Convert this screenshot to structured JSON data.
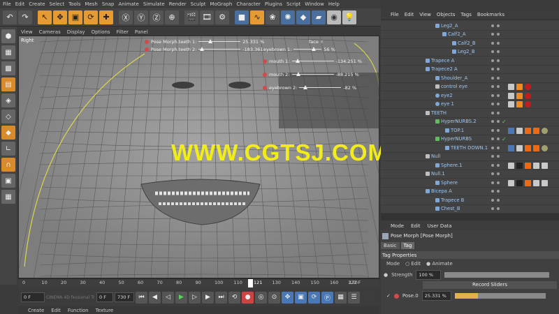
{
  "menubar": [
    "File",
    "Edit",
    "Create",
    "Select",
    "Tools",
    "Mesh",
    "Snap",
    "Animate",
    "Simulate",
    "Render",
    "Sculpt",
    "MoGraph",
    "Character",
    "Plugins",
    "Script",
    "Window",
    "Help"
  ],
  "viewport": {
    "menu": [
      "View",
      "Cameras",
      "Display",
      "Options",
      "Filter",
      "Panel"
    ],
    "name": "Right",
    "panel_label": "face",
    "sliders": [
      {
        "label": "Pose Morph.teeth 1:",
        "value": "25.331 %"
      },
      {
        "label": "Pose Morph.teeth 2:",
        "value": "-183.361"
      },
      {
        "label": "eyebrown 1:",
        "value": "56 %"
      },
      {
        "label": "mouth 1:",
        "value": "-134.251 %"
      },
      {
        "label": "mouth 2:",
        "value": "-88.215 %"
      },
      {
        "label": "eyebrown 2:",
        "value": "-82 %"
      }
    ]
  },
  "watermark": "WWW.CGTSJ.COM",
  "timeline": {
    "ticks": [
      "0",
      "10",
      "20",
      "30",
      "40",
      "50",
      "60",
      "70",
      "80",
      "90",
      "100",
      "110",
      "121",
      "130",
      "140",
      "150",
      "160",
      "170"
    ],
    "current_frame": "121",
    "end_frame": "122 F",
    "start_field": "0 F",
    "min_field": "0 F",
    "max_field": "730 F",
    "brand_text": "CINEMA 4D fessional Traini"
  },
  "bottom_menu": [
    "Create",
    "Edit",
    "Function",
    "Texture"
  ],
  "object_manager": {
    "menu": [
      "File",
      "Edit",
      "View",
      "Objects",
      "Tags",
      "Bookmarks"
    ],
    "rows": [
      {
        "name": "Leg2_A"
      },
      {
        "name": "Calf2_A"
      },
      {
        "name": "Calf2_B"
      },
      {
        "name": "Leg2_B"
      },
      {
        "name": "Trapece A"
      },
      {
        "name": "Trapece2 A"
      },
      {
        "name": "Shoulder_A"
      },
      {
        "name": "control eye"
      },
      {
        "name": "eye2"
      },
      {
        "name": "eye 1"
      },
      {
        "name": "TEETH"
      },
      {
        "name": "HyperNURBS.2"
      },
      {
        "name": "TOP.1"
      },
      {
        "name": "HyperNURBS"
      },
      {
        "name": "TEETH DOWN.1"
      },
      {
        "name": "Null"
      },
      {
        "name": "Sphere.1"
      },
      {
        "name": "Null.1"
      },
      {
        "name": "Sphere"
      },
      {
        "name": "Bicepa A"
      },
      {
        "name": "Trapece B"
      },
      {
        "name": "Chest_B"
      }
    ]
  },
  "attribute_manager": {
    "menu": [
      "Mode",
      "Edit",
      "User Data"
    ],
    "title": "Pose Morph [Pose Morph]",
    "tabs": [
      "Basic",
      "Tag"
    ],
    "active_tab": "Tag",
    "section": "Tag Properties",
    "mode_label": "Mode",
    "mode_edit": "Edit",
    "mode_animate": "Animate",
    "strength_label": "Strength",
    "strength_value": "100 %",
    "record_button": "Record Sliders",
    "pose_label": "Pose.0",
    "pose_value": "25.331 %"
  },
  "colors": {
    "accent": "#e59a32",
    "watermark": "#f2ec1a",
    "morph_dot": "#d24a4a",
    "object_text": "#9fc7ef"
  }
}
